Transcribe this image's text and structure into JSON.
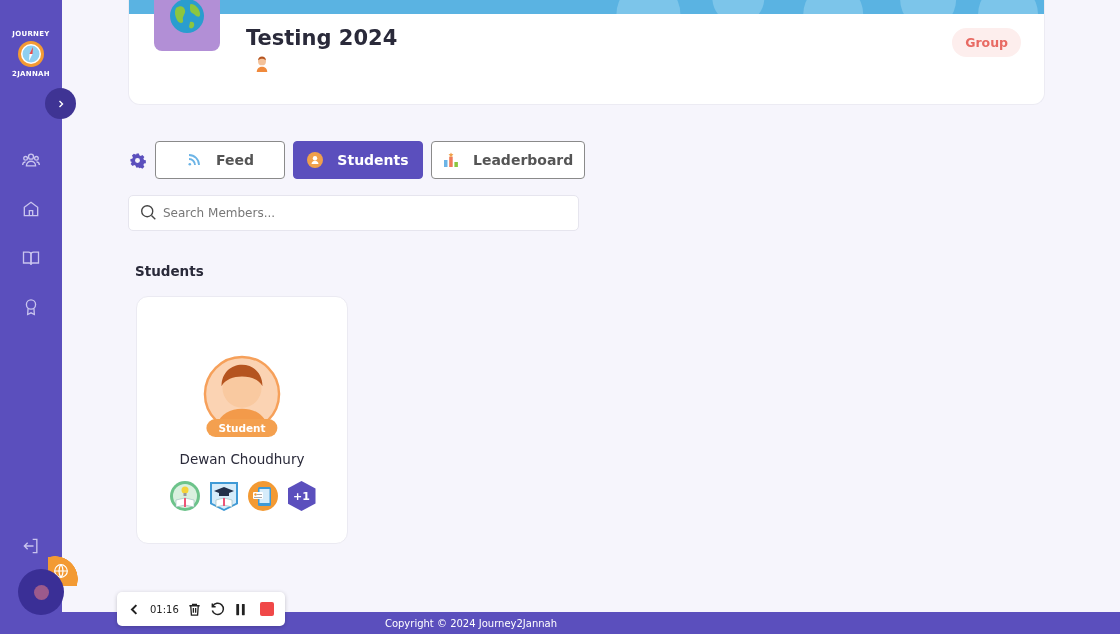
{
  "logo": {
    "top": "JOURNEY",
    "bottom": "2JANNAH"
  },
  "group": {
    "title": "Testing 2024",
    "type": "Group"
  },
  "tabs": [
    {
      "label": "Feed",
      "kind": "feed",
      "selected": false
    },
    {
      "label": "Students",
      "kind": "students",
      "selected": true
    },
    {
      "label": "Leaderboard",
      "kind": "leaderboard",
      "selected": false
    }
  ],
  "search": {
    "placeholder": "Search Members..."
  },
  "section_title": "Students",
  "members": [
    {
      "name": "Dewan Choudhury",
      "role": "Student",
      "badges": [
        {
          "kind": "idea"
        },
        {
          "kind": "graduate"
        },
        {
          "kind": "tablet"
        }
      ],
      "more": "+1"
    }
  ],
  "recorder": {
    "time": "01:16"
  },
  "footer": "Copyright © 2024 Journey2Jannah"
}
